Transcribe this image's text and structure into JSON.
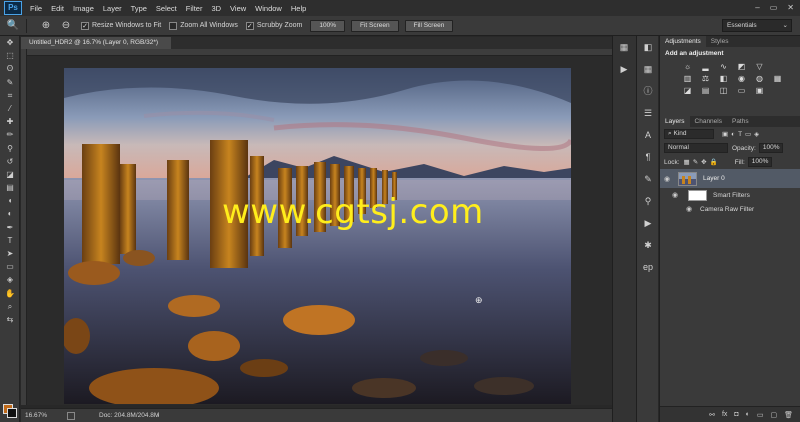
{
  "menubar": {
    "logo": "Ps",
    "items": [
      "File",
      "Edit",
      "Image",
      "Layer",
      "Type",
      "Select",
      "Filter",
      "3D",
      "View",
      "Window",
      "Help"
    ],
    "window_controls": [
      "–",
      "▭",
      "✕"
    ]
  },
  "options": {
    "resize_windows": "Resize Windows to Fit",
    "zoom_all": "Zoom All Windows",
    "scrubby_zoom": "Scrubby Zoom",
    "btn_100": "100%",
    "btn_fit": "Fit Screen",
    "btn_fill": "Fill Screen",
    "workspace": "Essentials"
  },
  "document": {
    "tab_title": "Untitled_HDR2 @ 16.7% (Layer 0, RGB/32*) *",
    "tab_close": "×"
  },
  "watermark": "www.cgtsj.com",
  "status": {
    "zoom": "16.67%",
    "doc": "Doc: 204.8M/204.8M",
    "arrow": "›"
  },
  "panels": {
    "top_tabs": [
      "Adjustments",
      "Styles"
    ],
    "adj_title": "Add an adjustment",
    "layer_tabs": [
      "Layers",
      "Channels",
      "Paths"
    ],
    "kind": "Kind",
    "blend": "Normal",
    "opacity_label": "Opacity:",
    "opacity_value": "100%",
    "lock_label": "Lock:",
    "fill_label": "Fill:",
    "fill_value": "100%",
    "layer_name": "Layer 0",
    "smart_filters": "Smart Filters",
    "camera_raw": "Camera Raw Filter"
  },
  "colors": {
    "foreground": "#c06a1a",
    "background": "#111111",
    "watermark": "#ffee1c",
    "selected_layer": "#525a66"
  }
}
